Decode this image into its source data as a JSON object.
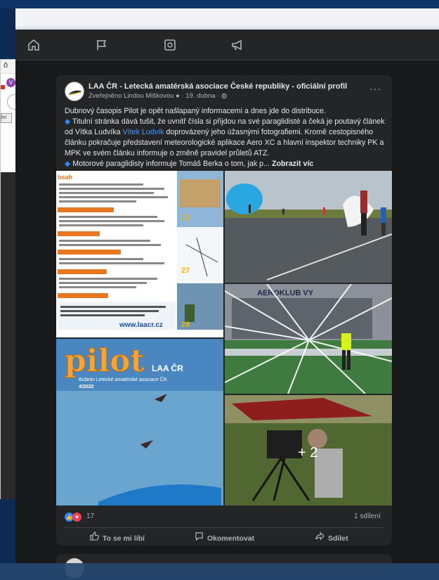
{
  "post": {
    "author": "LAA ČR - Letecká amatérská asociace České republiky - oficiální profil",
    "meta": "Zveřejněno Lindou Miškovou ● · 19. dubna · ◍",
    "more": "···",
    "text_lines": [
      "Dubnový časopis Pilot je opět našlapaný informacemi a dnes jde do distribuce.",
      "Titulní stránka dává tušit, že uvnitř čísla si přijdou na své paraglidisté a čeká je poutavý článek",
      "od Vítka Ludvíka",
      "doprovázený jeho úžasnými fotografiemi. Kromě cestopisného",
      "článku pokračuje představení meteorologické aplikace Aero XC a hlavní inspektor techniky PK a",
      "MPK ve svém článku informuje o změně pravidel průletů ATZ.",
      "Motorové paraglidisty informuje Tomáš Berka o tom, jak p...",
      "Zobrazit víc"
    ],
    "tag_link": "Vítek Ludvík",
    "photos": {
      "magazine_title": "pilot",
      "magazine_subtitle": "LAA ČR",
      "magazine_line": "Bulletin Letecké amatérské asociace ČR",
      "issue": "4/2022",
      "toc_title": "bsah",
      "toc_link": "www.laacr.cz",
      "page_numbers": [
        "12",
        "27",
        "28"
      ],
      "hangar_sign": "AEROKLUB VY",
      "more_photos": "+ 2"
    },
    "reactions": {
      "like_icon": "👍",
      "love_icon": "♥",
      "count": "17",
      "shares": "1 sdílení"
    },
    "actions": {
      "like": "To se mi líbí",
      "comment": "Okomentovat",
      "share": "Sdílet"
    }
  },
  "background_window": {
    "tab_control": "ō",
    "close": "✕",
    "avatar_letter": "V",
    "tooltip": "lní"
  },
  "colors": {
    "facebook_dark": "#18191a",
    "card": "#242526",
    "accent_blue": "#2d88ff"
  }
}
